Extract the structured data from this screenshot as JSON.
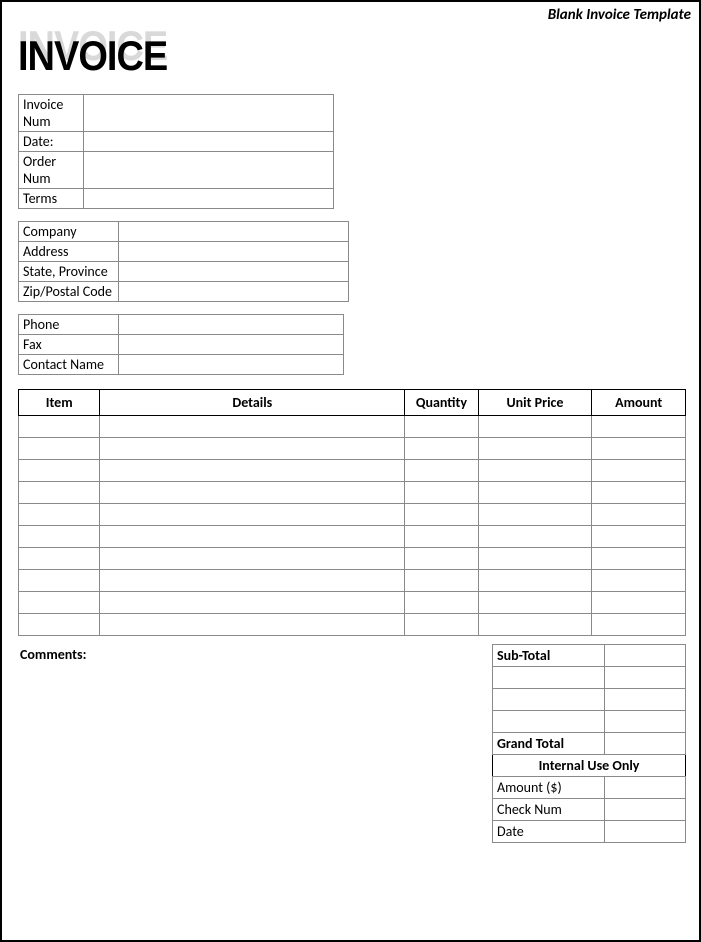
{
  "banner": "Blank Invoice Template",
  "title": "INVOICE",
  "block1": {
    "rows": [
      {
        "label": "Invoice Num",
        "value": ""
      },
      {
        "label": "Date:",
        "value": ""
      },
      {
        "label": "Order Num",
        "value": ""
      },
      {
        "label": "Terms",
        "value": ""
      }
    ]
  },
  "block2": {
    "rows": [
      {
        "label": "Company",
        "value": ""
      },
      {
        "label": "Address",
        "value": ""
      },
      {
        "label": "State, Province",
        "value": ""
      },
      {
        "label": "Zip/Postal Code",
        "value": ""
      }
    ]
  },
  "block3": {
    "rows": [
      {
        "label": "Phone",
        "value": ""
      },
      {
        "label": "Fax",
        "value": ""
      },
      {
        "label": "Contact Name",
        "value": ""
      }
    ]
  },
  "items": {
    "headers": [
      "Item",
      "Details",
      "Quantity",
      "Unit Price",
      "Amount"
    ],
    "rows": [
      [
        "",
        "",
        "",
        "",
        ""
      ],
      [
        "",
        "",
        "",
        "",
        ""
      ],
      [
        "",
        "",
        "",
        "",
        ""
      ],
      [
        "",
        "",
        "",
        "",
        ""
      ],
      [
        "",
        "",
        "",
        "",
        ""
      ],
      [
        "",
        "",
        "",
        "",
        ""
      ],
      [
        "",
        "",
        "",
        "",
        ""
      ],
      [
        "",
        "",
        "",
        "",
        ""
      ],
      [
        "",
        "",
        "",
        "",
        ""
      ],
      [
        "",
        "",
        "",
        "",
        ""
      ]
    ]
  },
  "comments_label": "Comments:",
  "totals": {
    "subtotal_label": "Sub-Total",
    "subtotal_value": "",
    "extra": [
      [
        "",
        ""
      ],
      [
        "",
        ""
      ],
      [
        "",
        ""
      ]
    ],
    "grandtotal_label": "Grand Total",
    "grandtotal_value": "",
    "internal_header": "Internal Use Only",
    "internal": [
      {
        "label": "Amount ($)",
        "value": ""
      },
      {
        "label": "Check Num",
        "value": ""
      },
      {
        "label": "Date",
        "value": ""
      }
    ]
  }
}
